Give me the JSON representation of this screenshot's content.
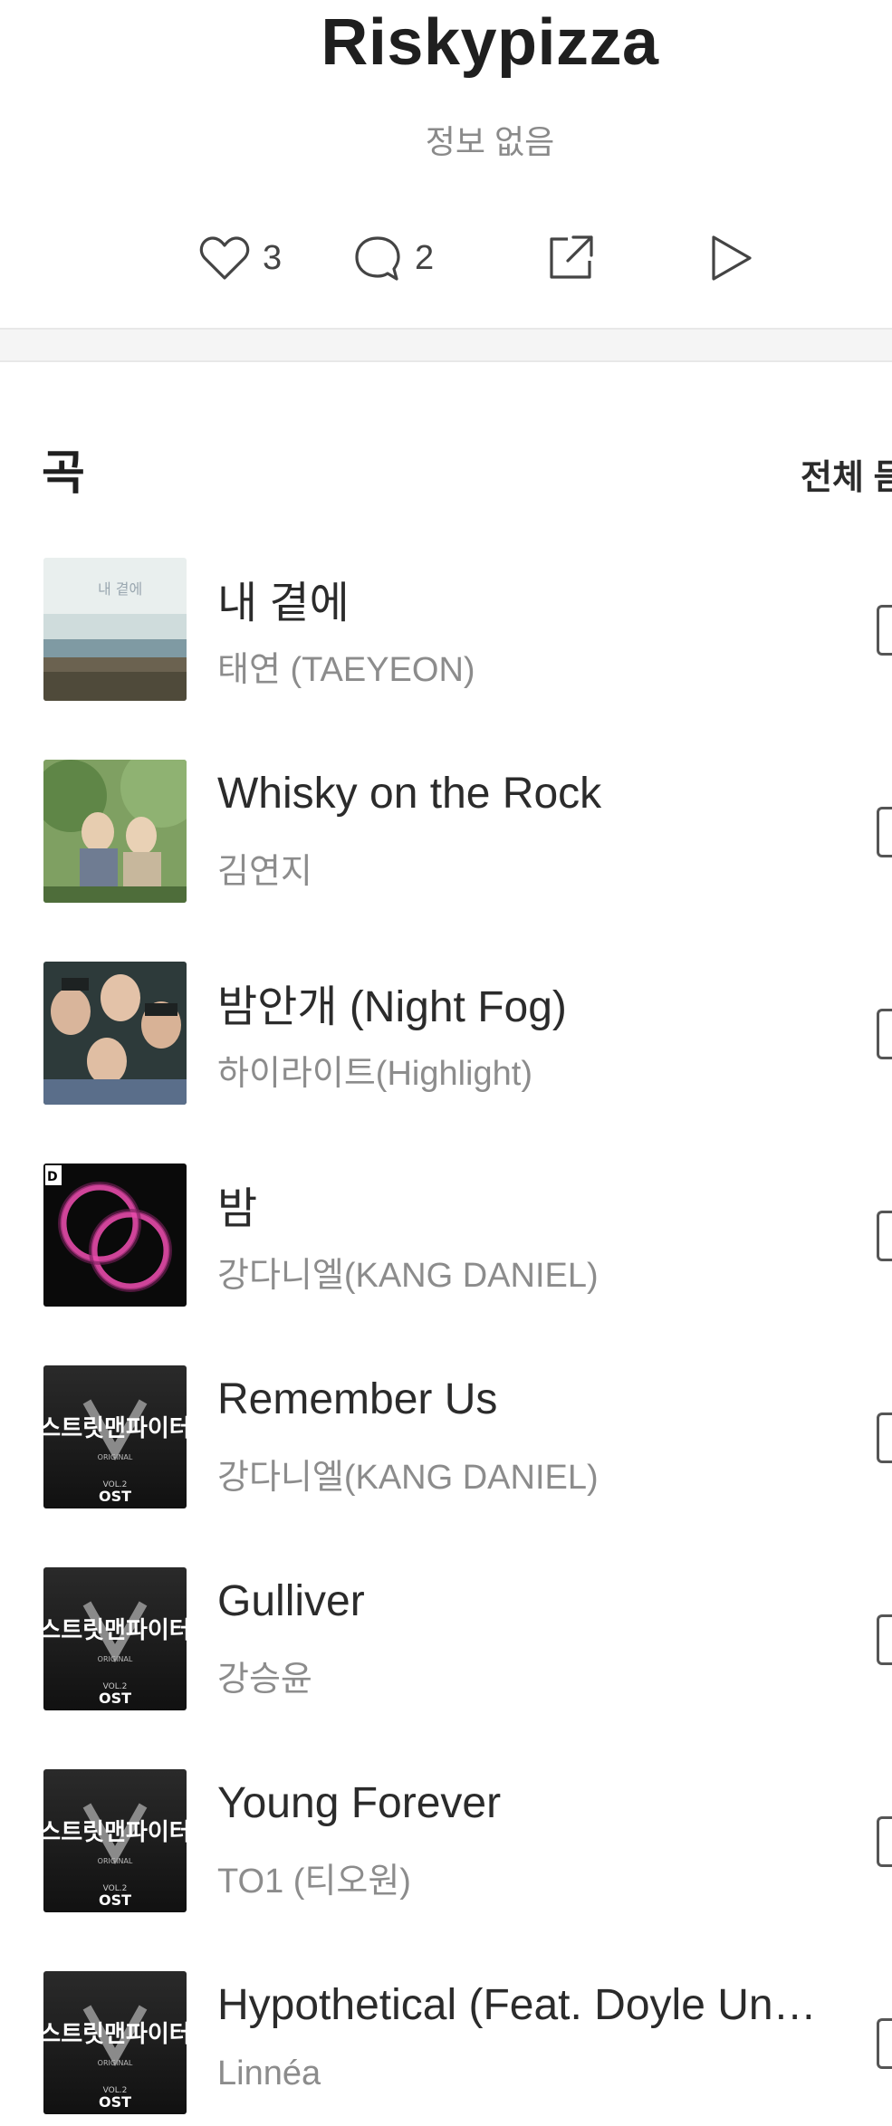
{
  "header": {
    "title": "Riskypizza",
    "subtitle": "정보 없음"
  },
  "actions": {
    "like_count": "3",
    "comment_count": "2",
    "like_icon": "heart-icon",
    "comment_icon": "comment-icon",
    "share_icon": "share-icon",
    "play_icon": "play-icon"
  },
  "songs": {
    "section_title": "곡",
    "play_all_label": "전체 듣",
    "tracks": [
      {
        "title": "내 곁에",
        "artist": "태연 (TAEYEON)"
      },
      {
        "title": "Whisky on the Rock",
        "artist": "김연지"
      },
      {
        "title": "밤안개 (Night Fog)",
        "artist": "하이라이트(Highlight)"
      },
      {
        "title": "밤",
        "artist": "강다니엘(KANG DANIEL)"
      },
      {
        "title": "Remember Us",
        "artist": "강다니엘(KANG DANIEL)"
      },
      {
        "title": "Gulliver",
        "artist": "강승윤"
      },
      {
        "title": "Young Forever",
        "artist": "TO1 (티오원)"
      },
      {
        "title": "Hypothetical (Feat. Doyle Un…",
        "artist": "Linnéa"
      }
    ],
    "ost_cover": {
      "line1": "스트릿맨파이터",
      "line2": "ORIGINAL",
      "line3": "VOL.2",
      "line4": "OST"
    }
  }
}
